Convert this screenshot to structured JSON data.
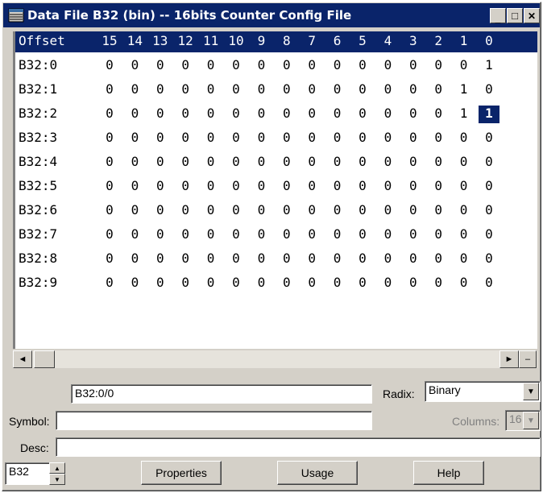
{
  "window": {
    "title": "Data File B32 (bin) -- 16bits Counter Config File",
    "minimize_glyph": "_",
    "maximize_glyph": "□",
    "close_glyph": "✕"
  },
  "grid": {
    "offset_header": "Offset",
    "bit_headers": [
      "15",
      "14",
      "13",
      "12",
      "11",
      "10",
      "9",
      "8",
      "7",
      "6",
      "5",
      "4",
      "3",
      "2",
      "1",
      "0"
    ],
    "rows": [
      {
        "offset": "B32:0",
        "bits": [
          "0",
          "0",
          "0",
          "0",
          "0",
          "0",
          "0",
          "0",
          "0",
          "0",
          "0",
          "0",
          "0",
          "0",
          "0",
          "1"
        ]
      },
      {
        "offset": "B32:1",
        "bits": [
          "0",
          "0",
          "0",
          "0",
          "0",
          "0",
          "0",
          "0",
          "0",
          "0",
          "0",
          "0",
          "0",
          "0",
          "1",
          "0"
        ]
      },
      {
        "offset": "B32:2",
        "bits": [
          "0",
          "0",
          "0",
          "0",
          "0",
          "0",
          "0",
          "0",
          "0",
          "0",
          "0",
          "0",
          "0",
          "0",
          "1",
          "1"
        ]
      },
      {
        "offset": "B32:3",
        "bits": [
          "0",
          "0",
          "0",
          "0",
          "0",
          "0",
          "0",
          "0",
          "0",
          "0",
          "0",
          "0",
          "0",
          "0",
          "0",
          "0"
        ]
      },
      {
        "offset": "B32:4",
        "bits": [
          "0",
          "0",
          "0",
          "0",
          "0",
          "0",
          "0",
          "0",
          "0",
          "0",
          "0",
          "0",
          "0",
          "0",
          "0",
          "0"
        ]
      },
      {
        "offset": "B32:5",
        "bits": [
          "0",
          "0",
          "0",
          "0",
          "0",
          "0",
          "0",
          "0",
          "0",
          "0",
          "0",
          "0",
          "0",
          "0",
          "0",
          "0"
        ]
      },
      {
        "offset": "B32:6",
        "bits": [
          "0",
          "0",
          "0",
          "0",
          "0",
          "0",
          "0",
          "0",
          "0",
          "0",
          "0",
          "0",
          "0",
          "0",
          "0",
          "0"
        ]
      },
      {
        "offset": "B32:7",
        "bits": [
          "0",
          "0",
          "0",
          "0",
          "0",
          "0",
          "0",
          "0",
          "0",
          "0",
          "0",
          "0",
          "0",
          "0",
          "0",
          "0"
        ]
      },
      {
        "offset": "B32:8",
        "bits": [
          "0",
          "0",
          "0",
          "0",
          "0",
          "0",
          "0",
          "0",
          "0",
          "0",
          "0",
          "0",
          "0",
          "0",
          "0",
          "0"
        ]
      },
      {
        "offset": "B32:9",
        "bits": [
          "0",
          "0",
          "0",
          "0",
          "0",
          "0",
          "0",
          "0",
          "0",
          "0",
          "0",
          "0",
          "0",
          "0",
          "0",
          "0"
        ]
      }
    ],
    "selected_cell": {
      "row": 2,
      "bit": 15
    }
  },
  "scrollbar": {
    "left_arrow": "◄",
    "right_arrow": "►",
    "split_glyph": "–"
  },
  "address": {
    "value": "B32:0/0"
  },
  "radix": {
    "label": "Radix:",
    "value": "Binary"
  },
  "symbol": {
    "label": "Symbol:",
    "value": ""
  },
  "columns": {
    "label": "Columns:",
    "value": "16"
  },
  "desc": {
    "label": "Desc:",
    "value": ""
  },
  "file_spinner": {
    "value": "B32"
  },
  "buttons": {
    "properties": "Properties",
    "usage": "Usage",
    "help": "Help"
  },
  "colors": {
    "titlebar": "#0a246a",
    "face": "#d4d0c8",
    "selection": "#0a246a"
  }
}
